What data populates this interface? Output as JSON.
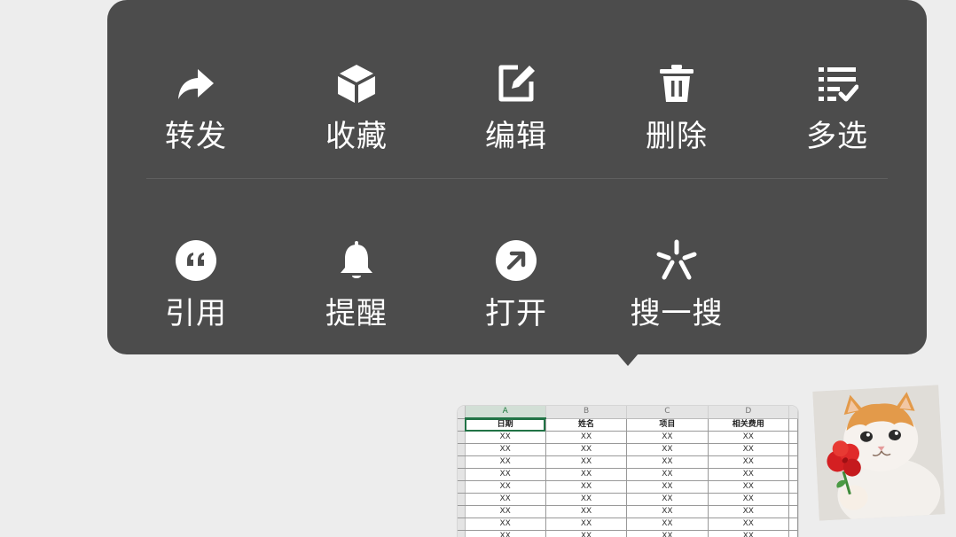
{
  "context_menu": {
    "row1": [
      {
        "label": "转发",
        "icon": "forward-icon"
      },
      {
        "label": "收藏",
        "icon": "favorite-cube-icon"
      },
      {
        "label": "编辑",
        "icon": "edit-icon"
      },
      {
        "label": "删除",
        "icon": "trash-icon"
      },
      {
        "label": "多选",
        "icon": "multi-select-icon"
      }
    ],
    "row2": [
      {
        "label": "引用",
        "icon": "quote-icon"
      },
      {
        "label": "提醒",
        "icon": "bell-icon"
      },
      {
        "label": "打开",
        "icon": "open-arrow-icon"
      },
      {
        "label": "搜一搜",
        "icon": "search-search-icon"
      }
    ]
  },
  "spreadsheet": {
    "columns": [
      "A",
      "B",
      "C",
      "D"
    ],
    "headers": [
      "日期",
      "姓名",
      "项目",
      "相关费用"
    ],
    "rows": [
      [
        "XX",
        "XX",
        "XX",
        "XX"
      ],
      [
        "XX",
        "XX",
        "XX",
        "XX"
      ],
      [
        "XX",
        "XX",
        "XX",
        "XX"
      ],
      [
        "XX",
        "XX",
        "XX",
        "XX"
      ],
      [
        "XX",
        "XX",
        "XX",
        "XX"
      ],
      [
        "XX",
        "XX",
        "XX",
        "XX"
      ],
      [
        "XX",
        "XX",
        "XX",
        "XX"
      ],
      [
        "XX",
        "XX",
        "XX",
        "XX"
      ],
      [
        "XX",
        "XX",
        "XX",
        "XX"
      ]
    ]
  },
  "sticker": {
    "icon": "cat-with-rose-sticker"
  },
  "colors": {
    "menu_bg": "#4c4c4c",
    "text": "#ffffff",
    "page_bg": "#ededed",
    "sheet_accent": "#217346"
  }
}
